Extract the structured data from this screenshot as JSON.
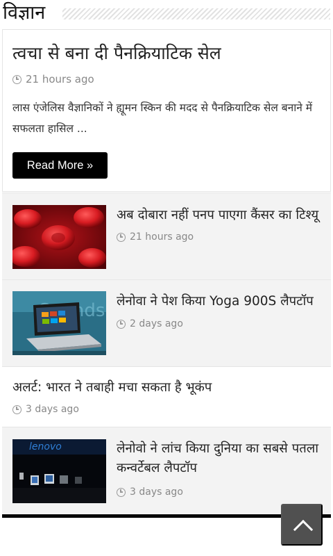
{
  "section": {
    "title": "विज्ञान"
  },
  "featured": {
    "title": "त्वचा से बना दी पैनक्रियाटिक सेल",
    "time": "21 hours ago",
    "excerpt": "लास एंजेलिस वैज्ञानिकों ने ह्यूमन स्किन की मदद से पैनक्रियाटिक सेल बनाने में सफलता हासिल ...",
    "read_more": "Read More »"
  },
  "items": [
    {
      "title": "अब दोबारा नहीं पनप पाएगा कैंसर का टिश्यू",
      "time": "21 hours ago",
      "thumb": "red-blood-cells"
    },
    {
      "title": "लेनोवा ने पेश किया Yoga 900S लैपटॉप",
      "time": "2 days ago",
      "thumb": "laptop",
      "thumb_text": "Sounds"
    },
    {
      "title": "अलर्ट: भारत ने तबाही मचा सकता है भूकंप",
      "time": "3 days ago"
    },
    {
      "title": "लेनोवो ने लांच किया दुनिया का सबसे पतला कन्वर्टेबल लैपटॉप",
      "time": "3 days ago",
      "thumb": "lenovo-stage",
      "thumb_text": "lenovo"
    }
  ],
  "scroll_top": {
    "icon": "chevron-up-icon"
  },
  "colors": {
    "button_bg": "#000000",
    "item_bg": "#f3f3f3",
    "scroll_bg": "#505050"
  }
}
